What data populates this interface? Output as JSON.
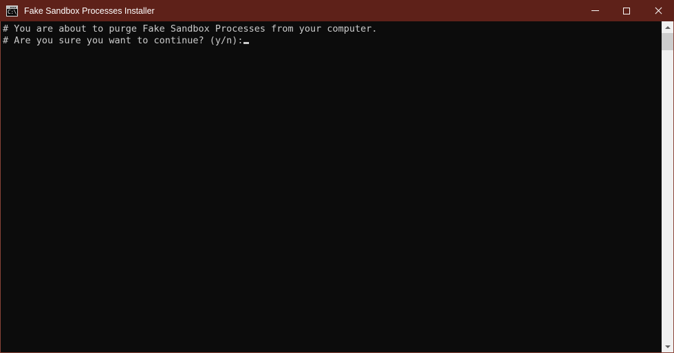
{
  "window": {
    "title": "Fake Sandbox Processes Installer",
    "icon": "console-window-icon",
    "icon_prompt_text": "C:\\_",
    "titlebar_color": "#5E2119",
    "frame_border_color": "#8A4438"
  },
  "caption_buttons": {
    "minimize_label": "Minimize",
    "maximize_label": "Maximize",
    "close_label": "Close"
  },
  "console": {
    "background_color": "#0C0C0C",
    "text_color": "#CCCCCC",
    "lines": [
      "# You are about to purge Fake Sandbox Processes from your computer.",
      "# Are you sure you want to continue? (y/n):"
    ],
    "cursor": "block",
    "prompt_options": "(y/n)"
  },
  "scrollbar": {
    "up_arrow_label": "Scroll up",
    "down_arrow_label": "Scroll down",
    "thumb_label": "Scroll thumb",
    "track_color": "#F0F0F0",
    "thumb_color": "#CDCDCD"
  }
}
